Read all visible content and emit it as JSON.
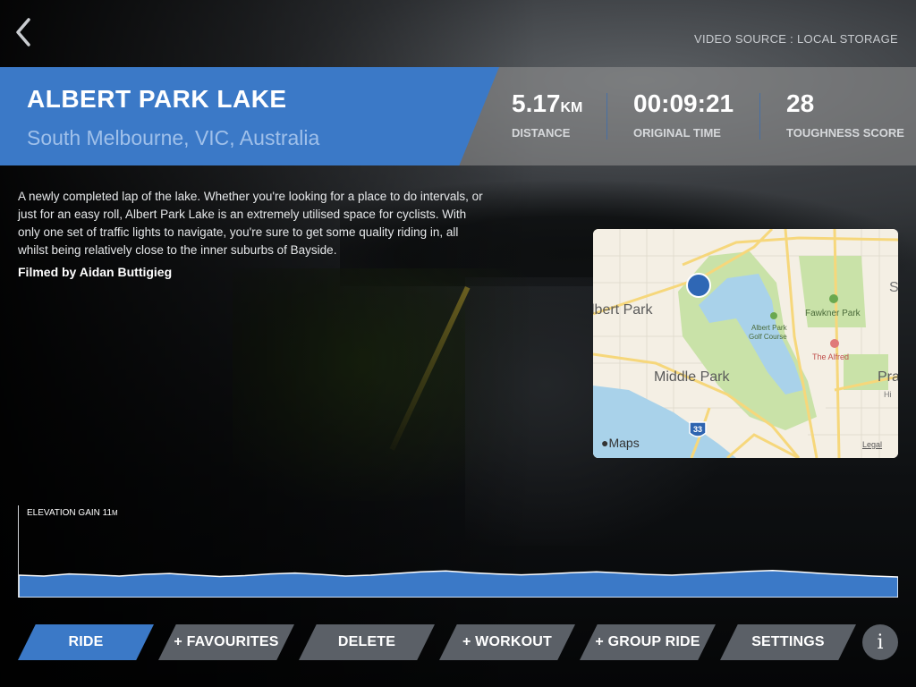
{
  "header": {
    "video_source": "VIDEO SOURCE : LOCAL STORAGE"
  },
  "route": {
    "title": "ALBERT PARK LAKE",
    "location": "South Melbourne, VIC, Australia",
    "description": "A newly completed lap of the lake. Whether you're looking for a place to do intervals, or just for an easy roll, Albert Park Lake is an extremely utilised space for cyclists. With only one set of traffic lights to navigate, you're sure to get some quality riding in, all whilst being relatively close to the inner suburbs of Bayside.",
    "filmed_by": "Filmed by Aidan Buttigieg"
  },
  "stats": {
    "distance": {
      "value": "5.17",
      "unit": "KM",
      "label": "DISTANCE"
    },
    "time": {
      "value": "00:09:21",
      "label": "ORIGINAL TIME"
    },
    "toughness": {
      "value": "28",
      "label": "TOUGHNESS SCORE"
    }
  },
  "map": {
    "labels": {
      "albert_park": "lbert Park",
      "middle_park": "Middle Park",
      "fawkner_park": "Fawkner Park",
      "golf_course_1": "Albert Park",
      "golf_course_2": "Golf Course",
      "alfred": "The Alfred",
      "s_edge": "S",
      "pra": "Pra",
      "hi": "Hi",
      "route_shield": "33"
    },
    "logo": "Maps",
    "legal": "Legal",
    "colors": {
      "park": "#c9e2a8",
      "water": "#a9d2ea",
      "road": "#f6d77b",
      "marker": "#2f67b5"
    }
  },
  "elevation": {
    "label": "ELEVATION GAIN",
    "value": "11",
    "unit": "M",
    "profile": [
      0.52,
      0.5,
      0.55,
      0.53,
      0.5,
      0.54,
      0.56,
      0.52,
      0.49,
      0.51,
      0.55,
      0.57,
      0.54,
      0.5,
      0.52,
      0.56,
      0.6,
      0.62,
      0.58,
      0.55,
      0.53,
      0.55,
      0.58,
      0.6,
      0.57,
      0.54,
      0.52,
      0.55,
      0.58,
      0.61,
      0.63,
      0.6,
      0.56,
      0.53,
      0.5,
      0.48
    ]
  },
  "buttons": {
    "ride": "RIDE",
    "favourites": "+ FAVOURITES",
    "delete": "DELETE",
    "workout": "+ WORKOUT",
    "group_ride": "+ GROUP RIDE",
    "settings": "SETTINGS",
    "info": "i"
  },
  "theme": {
    "accent": "#3b79c7",
    "button_gray": "#5b6067"
  }
}
